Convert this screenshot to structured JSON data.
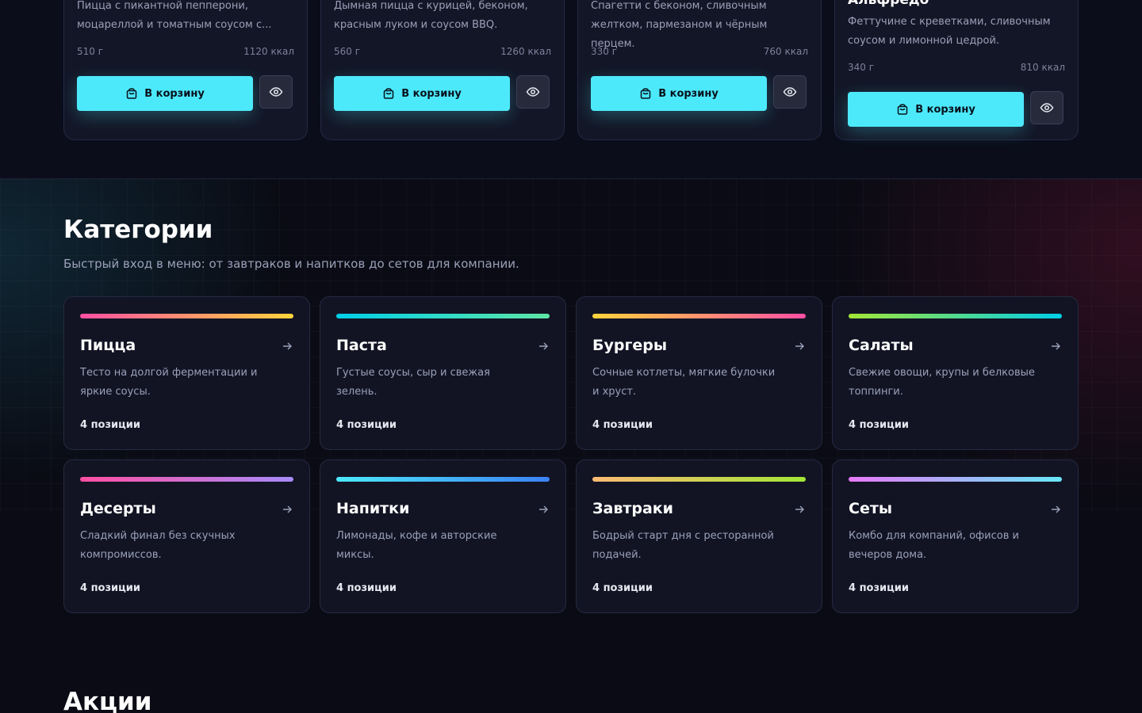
{
  "products": [
    {
      "title": "",
      "desc": "Пицца с пикантной пепперони, моцареллой и томатным соусом с...",
      "weight": "510 г",
      "kcal": "1120 ккал",
      "cart_label": "В корзину"
    },
    {
      "title": "",
      "desc": "Дымная пицца с курицей, беконом, красным луком и соусом BBQ.",
      "weight": "560 г",
      "kcal": "1260 ккал",
      "cart_label": "В корзину"
    },
    {
      "title": "",
      "desc": "Спагетти с беконом, сливочным желтком, пармезаном и чёрным перцем.",
      "weight": "330 г",
      "kcal": "760 ккал",
      "cart_label": "В корзину"
    },
    {
      "title": "Альфредо",
      "desc": "Феттучине с креветками, сливочным соусом и лимонной цедрой.",
      "weight": "340 г",
      "kcal": "810 ккал",
      "cart_label": "В корзину"
    }
  ],
  "categories_section": {
    "title": "Категории",
    "subtitle": "Быстрый вход в меню: от завтраков и напитков до сетов для компании."
  },
  "categories": [
    {
      "name": "Пицца",
      "desc": "Тесто на долгой ферментации и яркие соусы.",
      "count": "4 позиции",
      "gradient": [
        "#ff4fa3",
        "#ffd43b"
      ]
    },
    {
      "name": "Паста",
      "desc": "Густые соусы, сыр и свежая зелень.",
      "count": "4 позиции",
      "gradient": [
        "#00cfe8",
        "#5ee6a6"
      ]
    },
    {
      "name": "Бургеры",
      "desc": "Сочные котлеты, мягкие булочки и хруст.",
      "count": "4 позиции",
      "gradient": [
        "#ffd43b",
        "#ff4fa3"
      ]
    },
    {
      "name": "Салаты",
      "desc": "Свежие овощи, крупы и белковые топпинги.",
      "count": "4 позиции",
      "gradient": [
        "#a3e635",
        "#00cfe8"
      ]
    },
    {
      "name": "Десерты",
      "desc": "Сладкий финал без скучных компромиссов.",
      "count": "4 позиции",
      "gradient": [
        "#ff4fa3",
        "#a78bfa"
      ]
    },
    {
      "name": "Напитки",
      "desc": "Лимонады, кофе и авторские миксы.",
      "count": "4 позиции",
      "gradient": [
        "#4ce9fb",
        "#3b82f6"
      ]
    },
    {
      "name": "Завтраки",
      "desc": "Бодрый старт дня с ресторанной подачей.",
      "count": "4 позиции",
      "gradient": [
        "#fdba74",
        "#a3e635"
      ]
    },
    {
      "name": "Сеты",
      "desc": "Комбо для компаний, офисов и вечеров дома.",
      "count": "4 позиции",
      "gradient": [
        "#e879f9",
        "#67e8f9"
      ]
    }
  ],
  "promo_section": {
    "title": "Акции"
  },
  "colors": {
    "accent": "#4ce9fb",
    "background": "#0a0b14",
    "card": "#121424"
  },
  "icons": {
    "cart": "shopping-bag-icon",
    "view": "eye-icon",
    "arrow": "arrow-right-icon"
  }
}
